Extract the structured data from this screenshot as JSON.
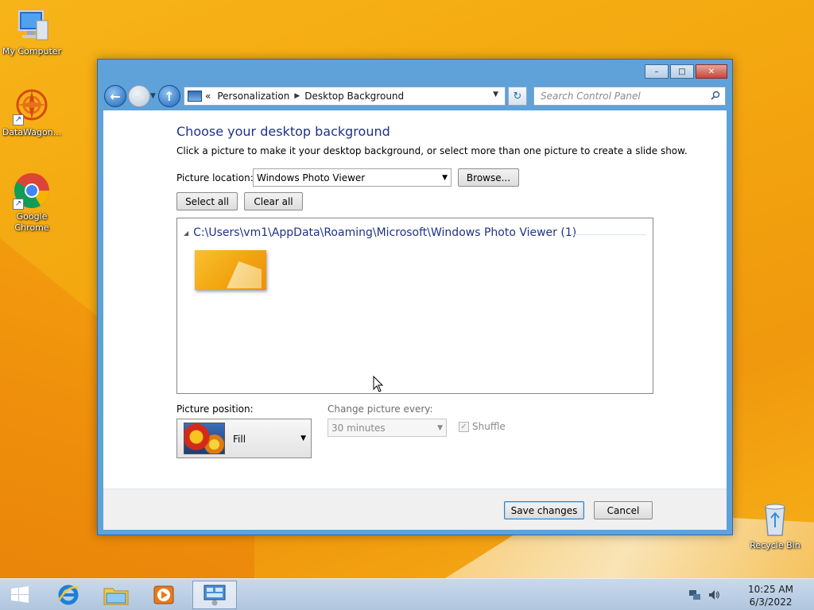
{
  "desktop": {
    "icons": [
      {
        "label": "My Computer"
      },
      {
        "label": "DataWagon..."
      },
      {
        "label": "Google Chrome"
      },
      {
        "label": "Recycle Bin"
      }
    ]
  },
  "window": {
    "controls": {
      "minimize": "–",
      "maximize": "□",
      "close": "✕"
    },
    "nav": {
      "back_glyph": "←",
      "forward_glyph": "→",
      "up_glyph": "↑",
      "breadcrumb_prefix": "«",
      "breadcrumb": [
        "Personalization",
        "Desktop Background"
      ],
      "breadcrumb_separator": "▶",
      "dropdown_glyph": "▼",
      "refresh_glyph": "↻",
      "search_placeholder": "Search Control Panel"
    },
    "content": {
      "heading": "Choose your desktop background",
      "subtext": "Click a picture to make it your desktop background, or select more than one picture to create a slide show.",
      "location_label": "Picture location:",
      "location_value": "Windows Photo Viewer",
      "browse_label": "Browse...",
      "select_all_label": "Select all",
      "clear_all_label": "Clear all",
      "group_toggle": "◢",
      "group_title": "C:\\Users\\vm1\\AppData\\Roaming\\Microsoft\\Windows Photo Viewer (1)",
      "position_label": "Picture position:",
      "position_value": "Fill",
      "change_label": "Change picture every:",
      "change_value": "30 minutes",
      "shuffle_label": "Shuffle",
      "shuffle_checked": true,
      "save_label": "Save changes",
      "cancel_label": "Cancel"
    }
  },
  "taskbar": {
    "clock_time": "10:25 AM",
    "clock_date": "6/3/2022"
  },
  "colors": {
    "desktop": "#f3a60f",
    "window_frame": "#5fa1d9",
    "heading": "#1e3287",
    "taskbar": "#b0c6de"
  }
}
